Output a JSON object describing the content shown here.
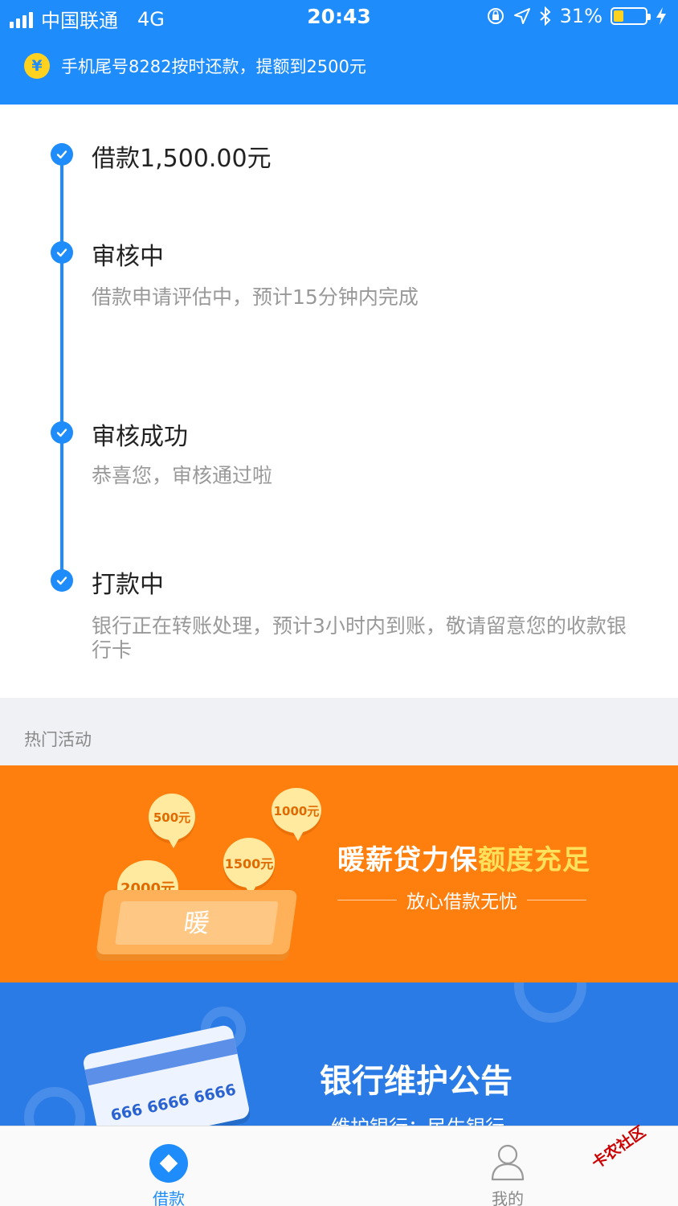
{
  "status_bar": {
    "carrier": "中国联通",
    "network": "4G",
    "time": "20:43",
    "battery": "31%",
    "battery_level": 0.31
  },
  "notice": {
    "icon": "yen-icon",
    "text": "手机尾号8282按时还款，提额到2500元"
  },
  "timeline": [
    {
      "title": "借款1,500.00元",
      "desc": ""
    },
    {
      "title": "审核中",
      "desc": "借款申请评估中，预计15分钟内完成"
    },
    {
      "title": "审核成功",
      "desc": "恭喜您，审核通过啦"
    },
    {
      "title": "打款中",
      "desc": "银行正在转账处理，预计3小时内到账，敬请留意您的收款银行卡"
    }
  ],
  "hot": {
    "title": "热门活动",
    "promo": {
      "bubbles": [
        "500元",
        "1000元",
        "1500元",
        "2000元"
      ],
      "tablet_char": "暖",
      "title_main": "暖薪贷力保",
      "title_highlight": "额度充足",
      "subtitle": "放心借款无忧"
    },
    "maintenance": {
      "card_number": "666 6666 6666",
      "title": "银行维护公告",
      "subtitle": "维护银行：民生银行"
    }
  },
  "tabbar": {
    "loan_label": "借款",
    "me_label": "我的",
    "active_color": "#1e8cfa",
    "inactive_color": "#888888"
  },
  "watermark": "卡农社区",
  "colors": {
    "primary": "#1e8cfa",
    "orange": "#ff7f0e",
    "blue_banner": "#2a7be6"
  }
}
